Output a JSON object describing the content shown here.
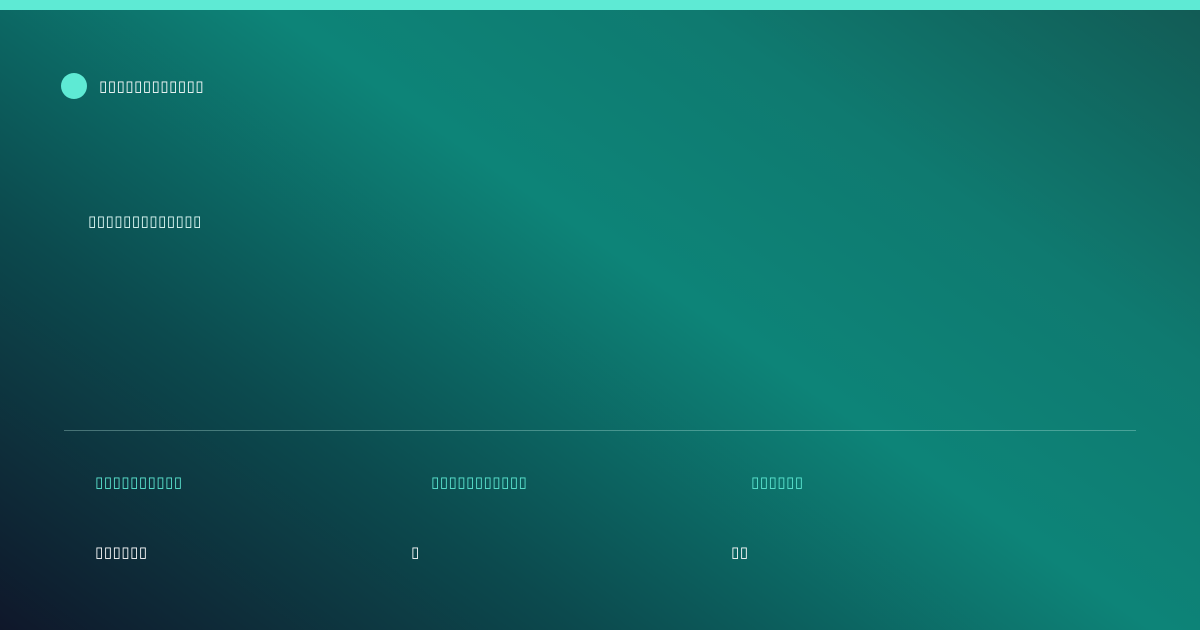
{
  "theme": {
    "accent": "#5eead4",
    "background_start": "#0f172a",
    "background_mid": "#0d8478",
    "background_end": "#125b55",
    "text": "#ffffff"
  },
  "brand": {
    "icon": "teal-circle-logo",
    "name": "▯▯▯▯▯▯▯▯▯▯▯▯"
  },
  "headline": "▯▯▯▯▯▯▯▯▯▯▯▯▯",
  "stats": [
    {
      "label": "▯▯▯▯▯▯▯▯▯▯",
      "value": "▯▯▯▯▯▯"
    },
    {
      "label": "▯▯▯▯▯▯▯▯▯▯▯",
      "value": "▯"
    },
    {
      "label": "▯▯▯▯▯▯",
      "value": "▯▯"
    }
  ]
}
